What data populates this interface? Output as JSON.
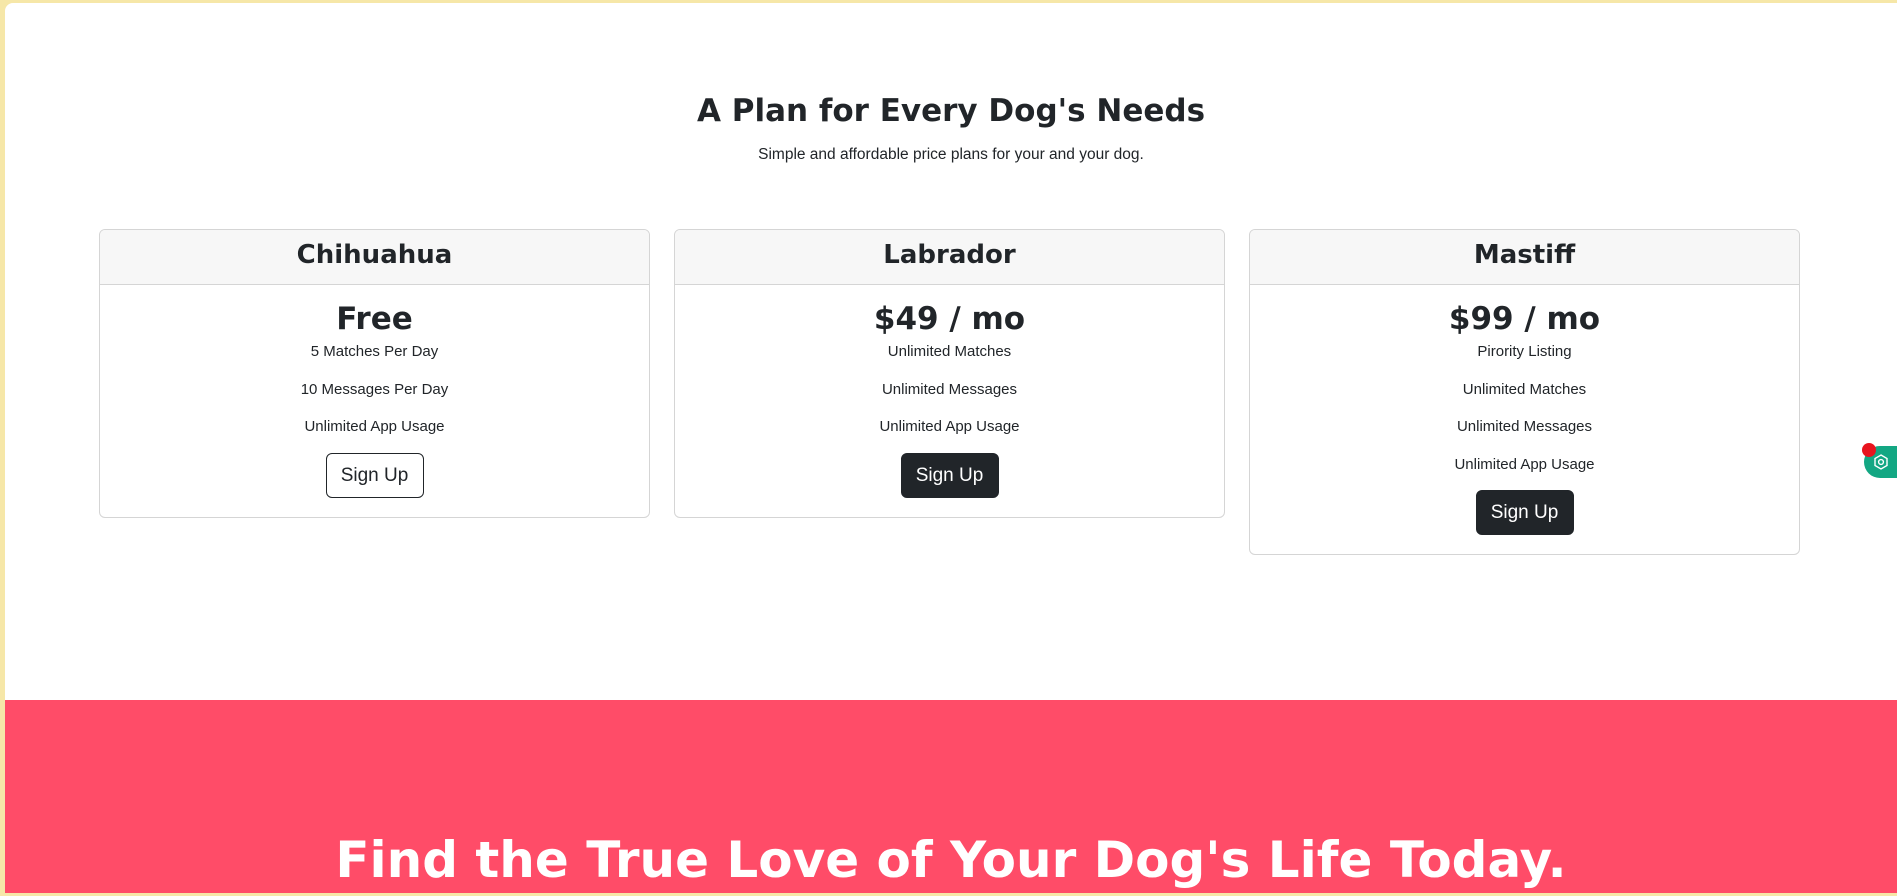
{
  "pricing": {
    "title": "A Plan for Every Dog's Needs",
    "subtitle": "Simple and affordable price plans for your and your dog.",
    "plans": [
      {
        "name": "Chihuahua",
        "price": "Free",
        "features": [
          "5 Matches Per Day",
          "10 Messages Per Day",
          "Unlimited App Usage"
        ],
        "button_label": "Sign Up",
        "button_style": "outline"
      },
      {
        "name": "Labrador",
        "price": "$49 / mo",
        "features": [
          "Unlimited Matches",
          "Unlimited Messages",
          "Unlimited App Usage"
        ],
        "button_label": "Sign Up",
        "button_style": "dark"
      },
      {
        "name": "Mastiff",
        "price": "$99 / mo",
        "features": [
          "Pirority Listing",
          "Unlimited Matches",
          "Unlimited Messages",
          "Unlimited App Usage"
        ],
        "button_label": "Sign Up",
        "button_style": "dark"
      }
    ]
  },
  "cta": {
    "title": "Find the True Love of Your Dog's Life Today."
  },
  "widget": {
    "icon": "hexagon-settings-icon",
    "notification": "red-dot"
  },
  "colors": {
    "cta_background": "#ff4c68",
    "dark_button": "#212529",
    "widget": "#13a783",
    "window_frame": "#f6e7a8"
  }
}
